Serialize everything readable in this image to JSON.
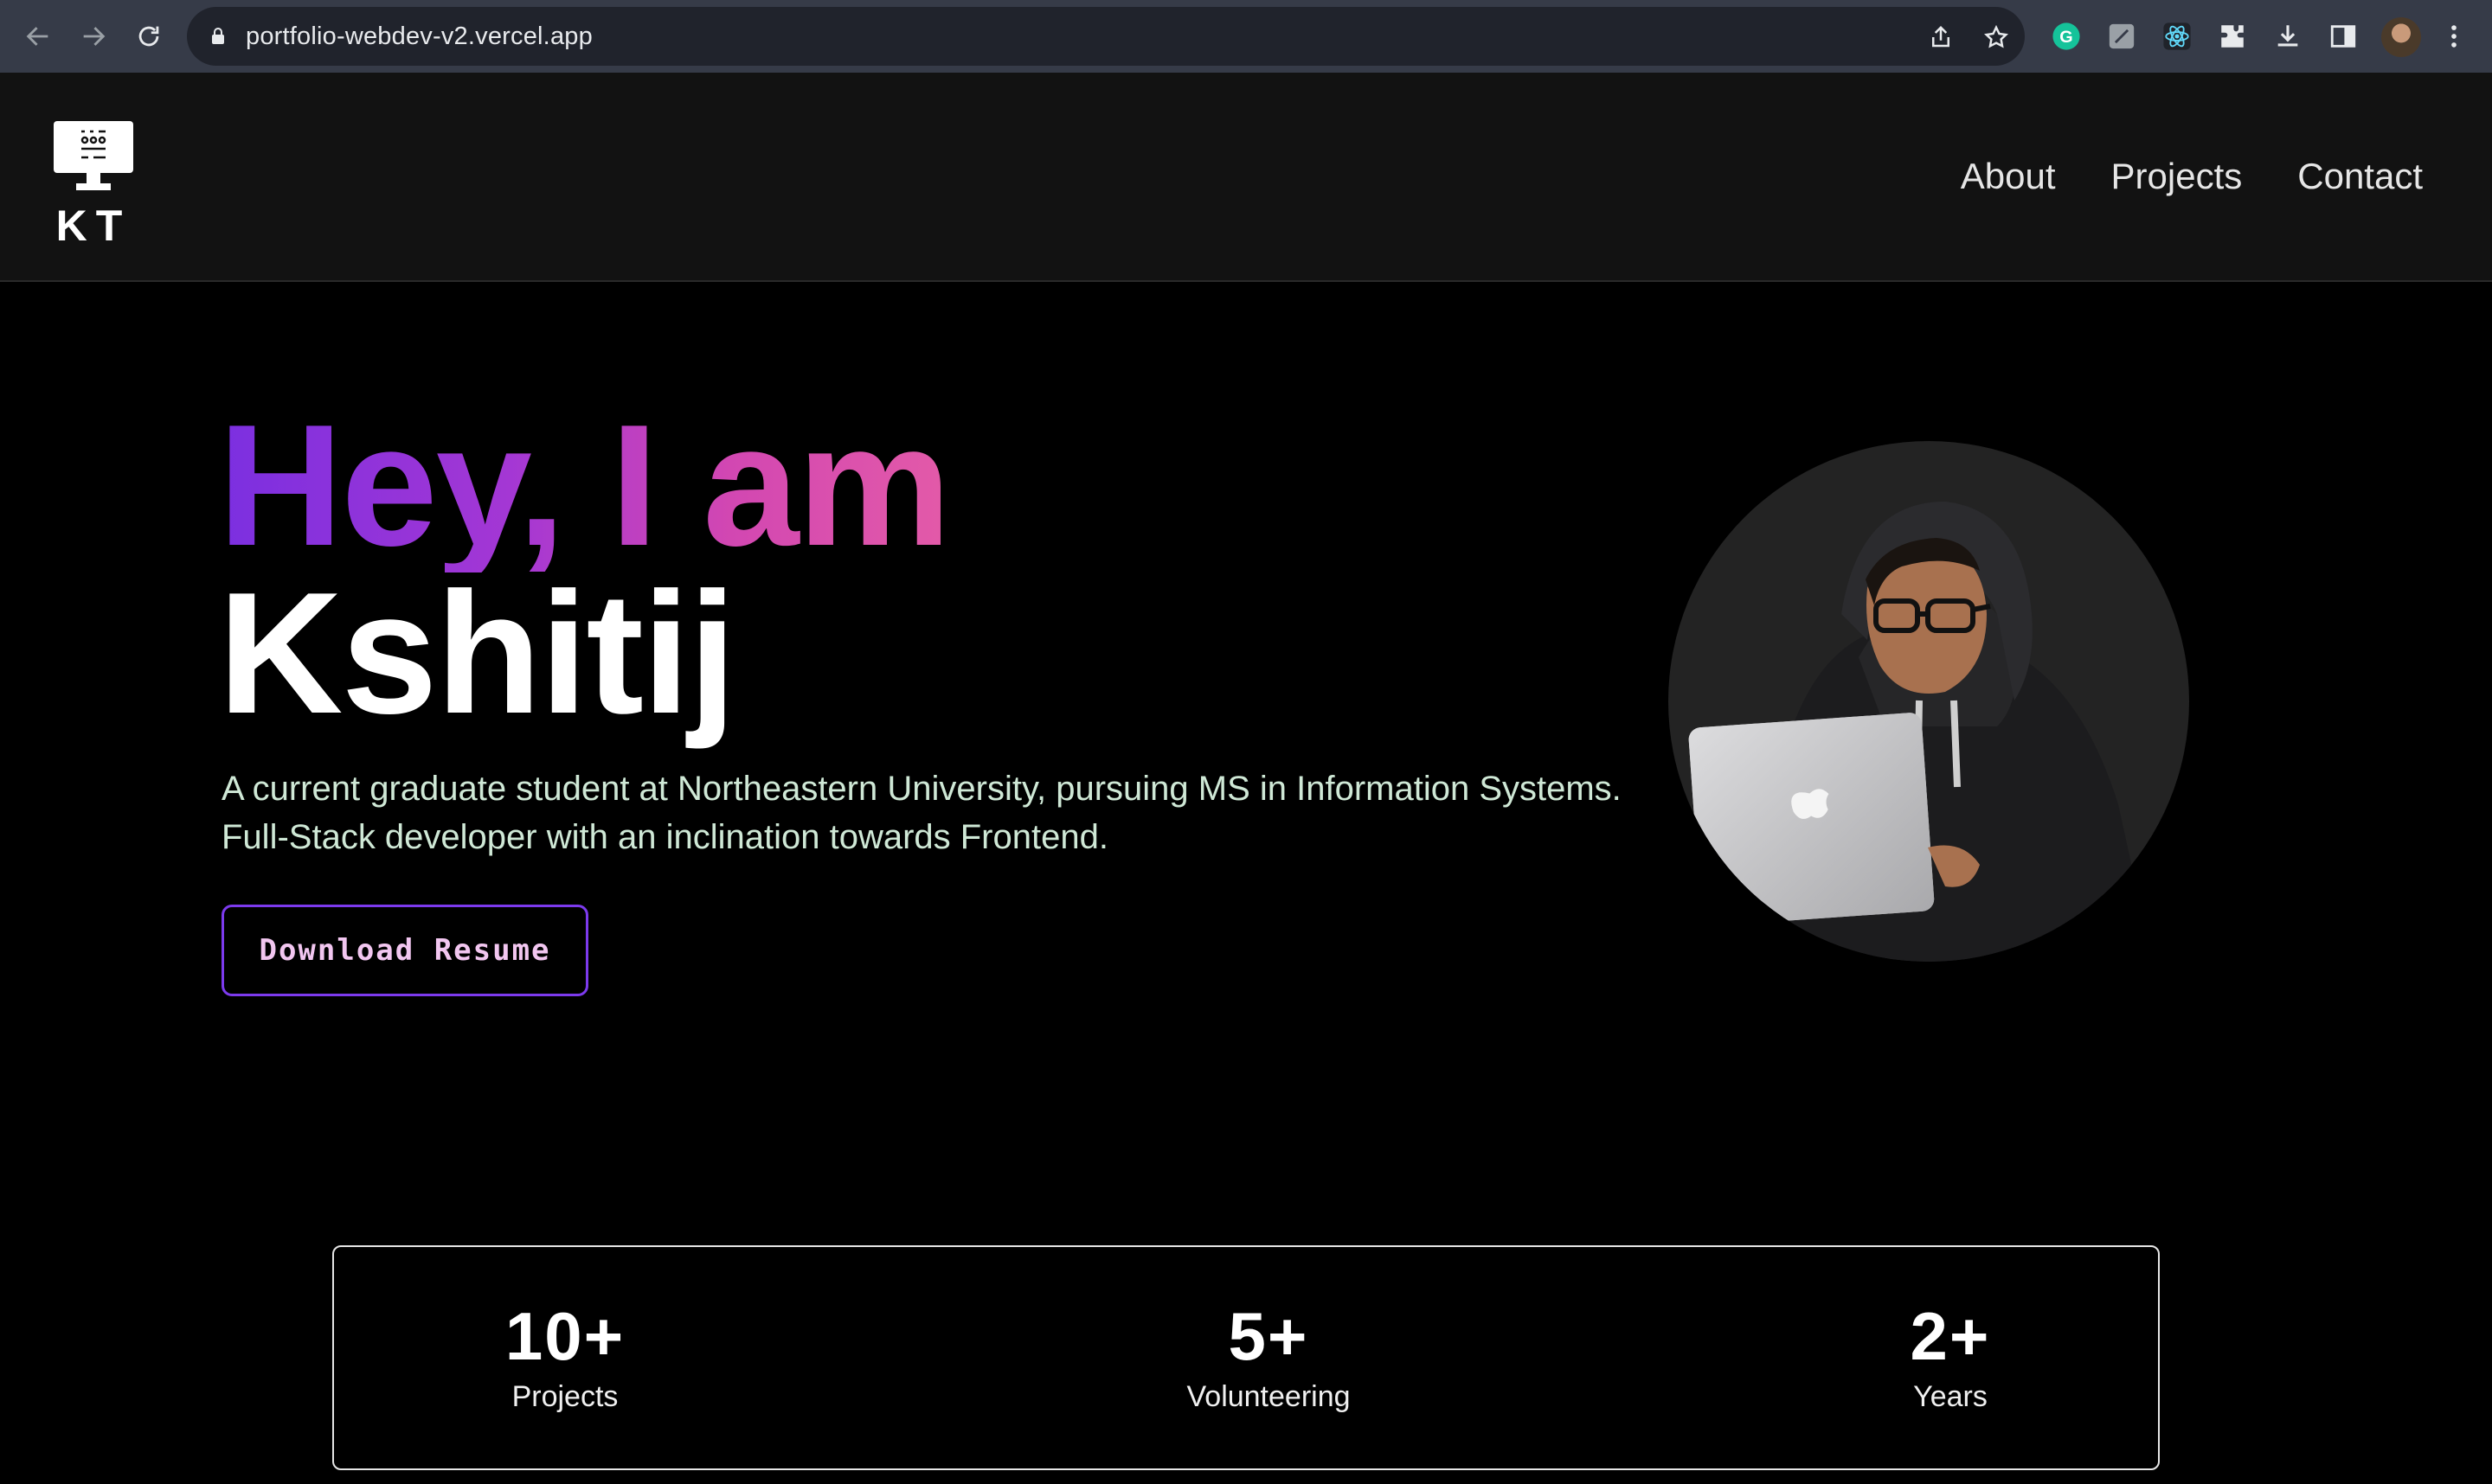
{
  "browser": {
    "url": "portfolio-webdev-v2.vercel.app"
  },
  "logo": {
    "text": "KT"
  },
  "nav": {
    "items": [
      {
        "label": "About"
      },
      {
        "label": "Projects"
      },
      {
        "label": "Contact"
      }
    ]
  },
  "hero": {
    "greeting": "Hey, I am",
    "name": "Kshitij",
    "description": "A current graduate student at Northeastern University, pursuing MS in Information Systems. Full-Stack developer with an inclination towards Frontend.",
    "resume_button": "Download Resume"
  },
  "stats": [
    {
      "value": "10+",
      "label": "Projects"
    },
    {
      "value": "5+",
      "label": "Volunteering"
    },
    {
      "value": "2+",
      "label": "Years"
    }
  ],
  "colors": {
    "accent": "#7c3aed",
    "gradient_start": "#7b2fe0",
    "gradient_end": "#e35aa8",
    "header_bg": "#121212",
    "page_bg": "#000000"
  }
}
